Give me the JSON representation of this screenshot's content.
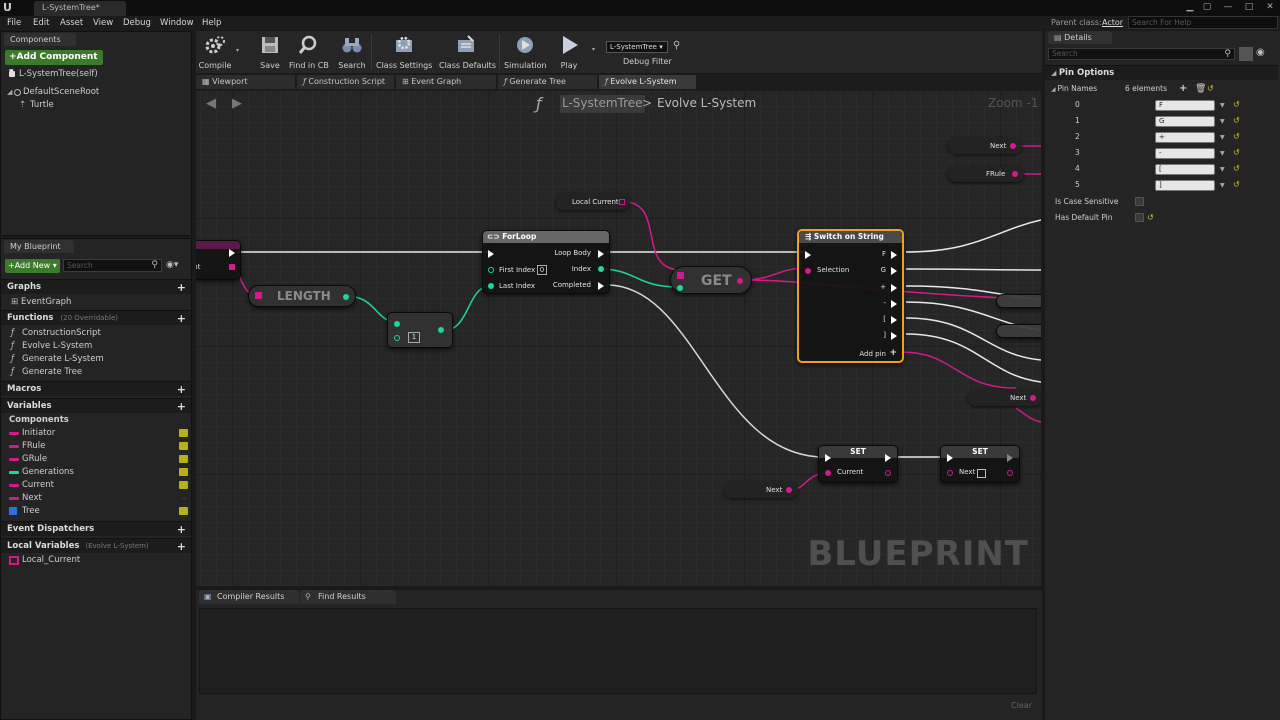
{
  "window": {
    "tab_title": "L-SystemTree*",
    "parent_class_label": "Parent class:",
    "parent_class_value": "Actor",
    "help_search_placeholder": "Search For Help"
  },
  "menu": [
    "File",
    "Edit",
    "Asset",
    "View",
    "Debug",
    "Window",
    "Help"
  ],
  "components_panel": {
    "tab": "Components",
    "add_button": "+Add Component ▾",
    "self_item": "L-SystemTree(self)",
    "tree": [
      "DefaultSceneRoot",
      "Turtle"
    ]
  },
  "my_blueprint": {
    "tab": "My Blueprint",
    "add_new": "+Add New ▾",
    "search_placeholder": "Search",
    "graphs_header": "Graphs",
    "graphs": [
      "EventGraph"
    ],
    "functions_header": "Functions",
    "functions_overridable": "(20 Overridable)",
    "functions": [
      "ConstructionScript",
      "Evolve L-System",
      "Generate L-System",
      "Generate Tree"
    ],
    "macros_header": "Macros",
    "variables_header": "Variables",
    "components_sub": "Components",
    "variables": [
      {
        "name": "Initiator",
        "color": "#d6188f",
        "eye": true
      },
      {
        "name": "FRule",
        "color": "#d6188f",
        "eye": true
      },
      {
        "name": "GRule",
        "color": "#d6188f",
        "eye": true
      },
      {
        "name": "Generations",
        "color": "#1ed79a",
        "eye": true
      },
      {
        "name": "Current",
        "color": "#d6188f",
        "eye": true
      },
      {
        "name": "Next",
        "color": "#d6188f",
        "eye": false
      },
      {
        "name": "Tree",
        "color": "#2f6fe0",
        "eye": true
      }
    ],
    "event_dispatchers_header": "Event Dispatchers",
    "local_variables_header": "Local Variables",
    "local_variables_scope": "(Evolve L-System)",
    "local_variables": [
      {
        "name": "Local_Current",
        "color": "#d6188f"
      }
    ]
  },
  "toolbar": {
    "compile": "Compile",
    "save": "Save",
    "find_in_cb": "Find in CB",
    "search": "Search",
    "class_settings": "Class Settings",
    "class_defaults": "Class Defaults",
    "simulation": "Simulation",
    "play": "Play",
    "debug_select": "L-SystemTree ▾",
    "debug_filter": "Debug Filter"
  },
  "graph_tabs": [
    "Viewport",
    "Construction Script",
    "Event Graph",
    "Generate Tree",
    "Evolve L-System"
  ],
  "graph": {
    "breadcrumb_root": "L-SystemTree",
    "breadcrumb_sep": ">",
    "breadcrumb_current": "Evolve L-System",
    "zoom": "Zoom -1",
    "watermark": "BLUEPRINT",
    "nodes": {
      "length": "LENGTH",
      "subtract_value": "1",
      "forloop_title": "ForLoop",
      "forloop_first_index": "First Index",
      "forloop_first_index_value": "0",
      "forloop_last_index": "Last Index",
      "forloop_loop_body": "Loop Body",
      "forloop_index": "Index",
      "forloop_completed": "Completed",
      "local_current": "Local Current",
      "get": "GET",
      "switch_title": "Switch on String",
      "switch_selection": "Selection",
      "switch_pins": [
        "F",
        "G",
        "+",
        "-",
        "[",
        "]"
      ],
      "switch_add_pin": "Add pin",
      "set1_title": "SET",
      "set1_pin": "Current",
      "set2_title": "SET",
      "set2_pin": "Next",
      "next_label": "Next",
      "frule_label": "FRule",
      "current_input_label": "ent"
    }
  },
  "bottom_tabs": [
    "Compiler Results",
    "Find Results"
  ],
  "bottom_clear": "Clear",
  "details": {
    "tab": "Details",
    "search_placeholder": "Search",
    "section": "Pin Options",
    "pin_names_label": "Pin Names",
    "pin_names_count": "6 elements",
    "pins": [
      {
        "index": "0",
        "value": "F"
      },
      {
        "index": "1",
        "value": "G"
      },
      {
        "index": "2",
        "value": "+"
      },
      {
        "index": "3",
        "value": "-"
      },
      {
        "index": "4",
        "value": "["
      },
      {
        "index": "5",
        "value": "]"
      }
    ],
    "is_case_sensitive": "Is Case Sensitive",
    "has_default_pin": "Has Default Pin"
  },
  "colors": {
    "string_pin": "#d6188f",
    "int_pin": "#1ed79a",
    "exec_wire": "#ffffff",
    "selected_outline": "#f0a020"
  }
}
